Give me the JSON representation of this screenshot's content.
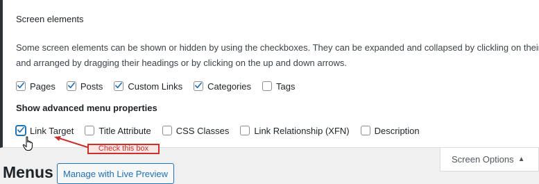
{
  "screen_elements": {
    "heading": "Screen elements",
    "description_line1": "Some screen elements can be shown or hidden by using the checkboxes. They can be expanded and collapsed by clickling on their h",
    "description_line2": "and arranged by dragging their headings or by clicking on the up and down arrows.",
    "options": [
      {
        "label": "Pages",
        "checked": true
      },
      {
        "label": "Posts",
        "checked": true
      },
      {
        "label": "Custom Links",
        "checked": true
      },
      {
        "label": "Categories",
        "checked": true
      },
      {
        "label": "Tags",
        "checked": false
      }
    ]
  },
  "advanced": {
    "heading": "Show advanced menu properties",
    "options": [
      {
        "label": "Link Target",
        "checked": true
      },
      {
        "label": "Title Attribute",
        "checked": false
      },
      {
        "label": "CSS Classes",
        "checked": false
      },
      {
        "label": "Link Relationship (XFN)",
        "checked": false
      },
      {
        "label": "Description",
        "checked": false
      }
    ]
  },
  "annotation": {
    "callout_text": "Check this box",
    "color": "#c9302c"
  },
  "screen_options": {
    "label": "Screen Options",
    "icon": "triangle-up-icon"
  },
  "page": {
    "title": "Menus",
    "live_preview_button": "Manage with Live Preview"
  },
  "colors": {
    "accent": "#2271b1",
    "panel_border": "#2c3338"
  }
}
